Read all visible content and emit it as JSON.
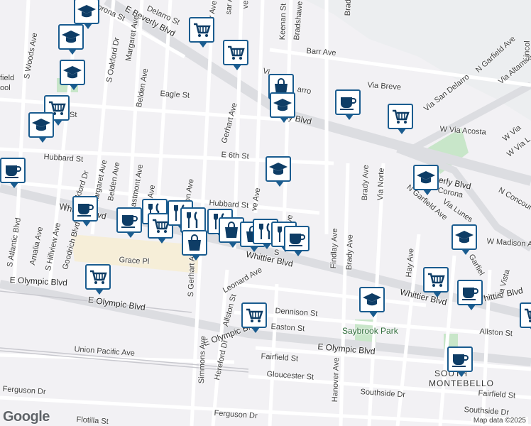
{
  "map": {
    "attribution": "Map data ©2025",
    "logo": "Google",
    "area_label_1": "SOUTH",
    "area_label_2": "MONTEBELLO",
    "park": "Saybrook Park",
    "colors": {
      "background": "#f2f1f4",
      "road": "#ffffff",
      "highway": "#dcdde1",
      "park": "#c8e6c9",
      "beige": "#f6eed8",
      "pin_border": "#1a5c8f",
      "pin_icon": "#0e3d66"
    }
  },
  "streets": {
    "beverly_upper": "E Beverly Blvd",
    "beverly_right": "W Beverly Blvd",
    "beverly_mid": "erly Blvd",
    "whittier_left": "Whittier Blvd",
    "whittier_mid": "Whittier Blvd",
    "whittier_right": "Whittier Blvd",
    "whittier_far": "W Whittier Blvd",
    "olympic_left": "E Olympic Blvd",
    "olympic_mid": "E Olympic Blvd",
    "olympic_right": "E Olympic Blvd",
    "atlantic": "S Atlantic Blvd",
    "woods": "S Woods Ave",
    "oakford_top": "S Oakford Dr",
    "oakford": "Oakford Dr",
    "margaret_top": "Margaret Ave",
    "margaret": "Margaret Ave",
    "belden_top": "Belden Ave",
    "belden": "Belden Ave",
    "gerhart": "Gerhart Ave",
    "s_gerhart": "S Gerhart Ave",
    "eastmont": "astmont Ave",
    "hubbard_left": "Hubbard St",
    "hubbard_right": "Hubbard St",
    "e6th": "E 6th St",
    "eagle": "Eagle St",
    "st_short": "St",
    "barr": "Barr Ave",
    "keenan": "Keenan St",
    "bradshawe": "Bradshawe St",
    "via_breve": "Via Breve",
    "via_san_delarro": "Via San Delarro",
    "delarro": "Delarro St",
    "corona_top": "orona St",
    "corona_right": "Corona",
    "acosta": "W Via Acosta",
    "n_garfield_top": "N Garfield Ave",
    "n_garfield": "N Garfield Ave",
    "via_altamira": "Via Altamira",
    "via_norte": "Via Norte",
    "brady_top": "Brady Ave",
    "brady": "Brady Ave",
    "findlay": "Findlay Ave",
    "hay": "Hay Ave",
    "grace": "Grace Pl",
    "leonard": "Leonard Ave",
    "allston_v": "Allston St",
    "allston": "Allston St",
    "dennison": "Dennison St",
    "easton": "Easton St",
    "union_pacific": "Union Pacific Ave",
    "simmons": "Simmons Ave",
    "hereford": "Hereford Dr",
    "fairfield_mid": "Fairfield St",
    "fairfield_right": "Fairfield St",
    "gloucester": "Gloucester St",
    "hanover": "Hanover Ave",
    "southside_mid": "Southside Dr",
    "southside_right": "Southside Dr",
    "ferguson_left": "Ferguson Dr",
    "ferguson_mid": "Ferguson Dr",
    "flotilla": "Flotilla St",
    "amalia": "Amalia Ave",
    "hillview": "S Hillview Ave",
    "goodrich": "Goodrich Blvd",
    "concourse": "N Concourse",
    "w_madison": "W Madison A",
    "lincoln": "Lincol",
    "w_via_l": "W Via L",
    "w_via": "W Via",
    "lunes": "Via Lunes",
    "garfiel": "Garfiel",
    "vista": "Via Vista",
    "ve_top1": "ve",
    "ve_top2": "sar Ave",
    "field": "field",
    "ool": "ool",
    "ave_hub": "ve Ave",
    "ve_mid": "Ave",
    "er_ave": "er Ave",
    "on_ave": "on Ave",
    "sel_ave": "ser Ave",
    "s_mid": "S",
    "via_v": "Vi",
    "arro": "arro",
    "wh_stub": "W"
  },
  "pins": [
    {
      "kind": "school",
      "icon": "mortarboard-icon"
    },
    {
      "kind": "school",
      "icon": "mortarboard-icon"
    },
    {
      "kind": "grocery",
      "icon": "cart-icon"
    },
    {
      "kind": "grocery",
      "icon": "cart-icon"
    },
    {
      "kind": "school",
      "icon": "mortarboard-icon"
    },
    {
      "kind": "grocery",
      "icon": "cart-icon"
    },
    {
      "kind": "school",
      "icon": "mortarboard-icon"
    },
    {
      "kind": "shopping",
      "icon": "bag-icon"
    },
    {
      "kind": "school",
      "icon": "mortarboard-icon"
    },
    {
      "kind": "cafe",
      "icon": "cup-icon"
    },
    {
      "kind": "grocery",
      "icon": "cart-icon"
    },
    {
      "kind": "school",
      "icon": "mortarboard-icon"
    },
    {
      "kind": "cafe",
      "icon": "cup-icon"
    },
    {
      "kind": "school",
      "icon": "mortarboard-icon"
    },
    {
      "kind": "cafe",
      "icon": "cup-icon"
    },
    {
      "kind": "cafe",
      "icon": "cup-icon"
    },
    {
      "kind": "restaurant",
      "icon": "fork-knife-icon"
    },
    {
      "kind": "grocery",
      "icon": "cart-icon"
    },
    {
      "kind": "restaurant",
      "icon": "fork-knife-icon"
    },
    {
      "kind": "restaurant",
      "icon": "fork-knife-icon"
    },
    {
      "kind": "restaurant",
      "icon": "fork-knife-icon"
    },
    {
      "kind": "shopping",
      "icon": "bag-icon"
    },
    {
      "kind": "shopping",
      "icon": "bag-icon"
    },
    {
      "kind": "restaurant",
      "icon": "fork-knife-icon"
    },
    {
      "kind": "restaurant",
      "icon": "fork-knife-icon"
    },
    {
      "kind": "shopping",
      "icon": "bag-icon"
    },
    {
      "kind": "school",
      "icon": "mortarboard-icon"
    },
    {
      "kind": "grocery",
      "icon": "cart-icon"
    },
    {
      "kind": "cafe",
      "icon": "cup-icon"
    },
    {
      "kind": "grocery",
      "icon": "cart-icon"
    },
    {
      "kind": "grocery",
      "icon": "cart-icon"
    },
    {
      "kind": "school",
      "icon": "mortarboard-icon"
    },
    {
      "kind": "cafe",
      "icon": "cup-icon"
    },
    {
      "kind": "grocery",
      "icon": "cart-icon"
    },
    {
      "kind": "cafe",
      "icon": "cup-icon"
    }
  ]
}
